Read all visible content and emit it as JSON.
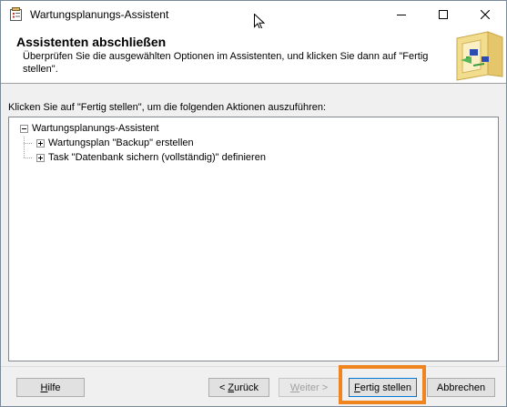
{
  "window": {
    "title": "Wartungsplanungs-Assistent",
    "icon": "wizard-app-icon"
  },
  "header": {
    "title": "Assistenten abschließen",
    "description": "Überprüfen Sie die ausgewählten Optionen im Assistenten, und klicken Sie dann auf \"Fertig stellen\"."
  },
  "main": {
    "instruction": "Klicken Sie auf \"Fertig stellen\", um die folgenden Aktionen auszuführen:",
    "tree": {
      "root": "Wartungsplanungs-Assistent",
      "children": [
        "Wartungsplan \"Backup\" erstellen",
        "Task \"Datenbank sichern (vollständig)\" definieren"
      ]
    }
  },
  "buttons": {
    "help": {
      "mnemonic": "H",
      "rest": "ilfe"
    },
    "back": {
      "prefix": "< ",
      "mnemonic": "Z",
      "rest": "urück"
    },
    "next": {
      "mnemonic": "W",
      "rest": "eiter >"
    },
    "finish": {
      "mnemonic": "F",
      "rest": "ertig stellen"
    },
    "cancel": "Abbrechen"
  },
  "colors": {
    "highlight": "#f0841e",
    "default_button_border": "#0078d7"
  }
}
